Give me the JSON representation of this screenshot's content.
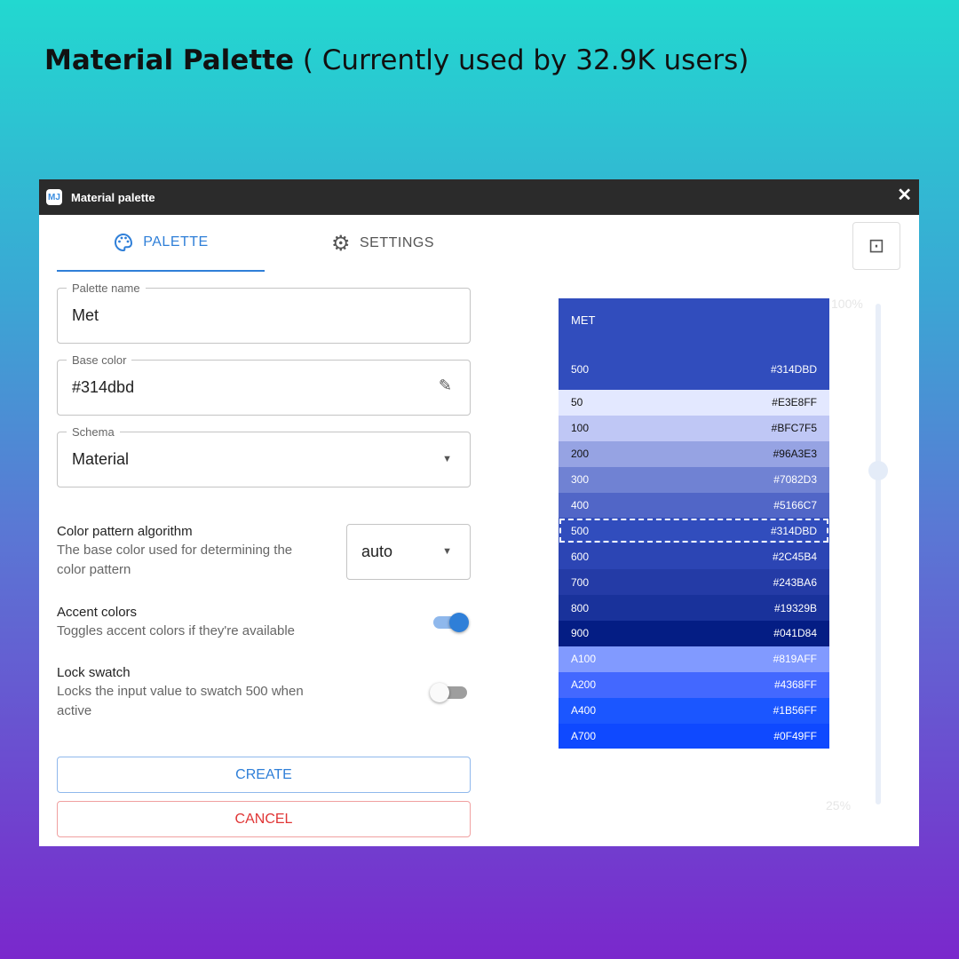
{
  "headline": {
    "bold": "Material Palette",
    "rest": " ( Currently used by 32.9K users)"
  },
  "window": {
    "title": "Material palette",
    "logo": "MJ"
  },
  "tabs": [
    {
      "label": "PALETTE",
      "icon": "palette-icon"
    },
    {
      "label": "SETTINGS",
      "icon": "gear-icon"
    }
  ],
  "form": {
    "palette_name": {
      "label": "Palette name",
      "value": "Met"
    },
    "base_color": {
      "label": "Base color",
      "value": "#314dbd"
    },
    "schema": {
      "label": "Schema",
      "value": "Material"
    },
    "algorithm": {
      "title": "Color pattern algorithm",
      "desc": "The base color used for determining the color pattern",
      "value": "auto"
    },
    "accent": {
      "title": "Accent colors",
      "desc": "Toggles accent colors if they're available",
      "on": true
    },
    "lock": {
      "title": "Lock swatch",
      "desc": "Locks the input value to swatch 500 when active",
      "on": false
    },
    "create": "CREATE",
    "cancel": "CANCEL"
  },
  "colors": {
    "accent": "#2f7fd8",
    "cancel": "#e03535"
  },
  "palette": {
    "name": "MET",
    "main_shade": "500",
    "main_hex": "#314DBD",
    "swatches": [
      {
        "shade": "50",
        "hex": "#E3E8FF"
      },
      {
        "shade": "100",
        "hex": "#BFC7F5"
      },
      {
        "shade": "200",
        "hex": "#96A3E3"
      },
      {
        "shade": "300",
        "hex": "#7082D3"
      },
      {
        "shade": "400",
        "hex": "#5166C7"
      },
      {
        "shade": "500",
        "hex": "#314DBD",
        "selected": true
      },
      {
        "shade": "600",
        "hex": "#2C45B4"
      },
      {
        "shade": "700",
        "hex": "#243BA6"
      },
      {
        "shade": "800",
        "hex": "#19329B"
      },
      {
        "shade": "900",
        "hex": "#041D84"
      },
      {
        "shade": "A100",
        "hex": "#819AFF"
      },
      {
        "shade": "A200",
        "hex": "#4368FF"
      },
      {
        "shade": "A400",
        "hex": "#1B56FF"
      },
      {
        "shade": "A700",
        "hex": "#0F49FF"
      }
    ]
  },
  "zoom": {
    "max": "100%",
    "min": "25%",
    "value_percent": 75
  }
}
